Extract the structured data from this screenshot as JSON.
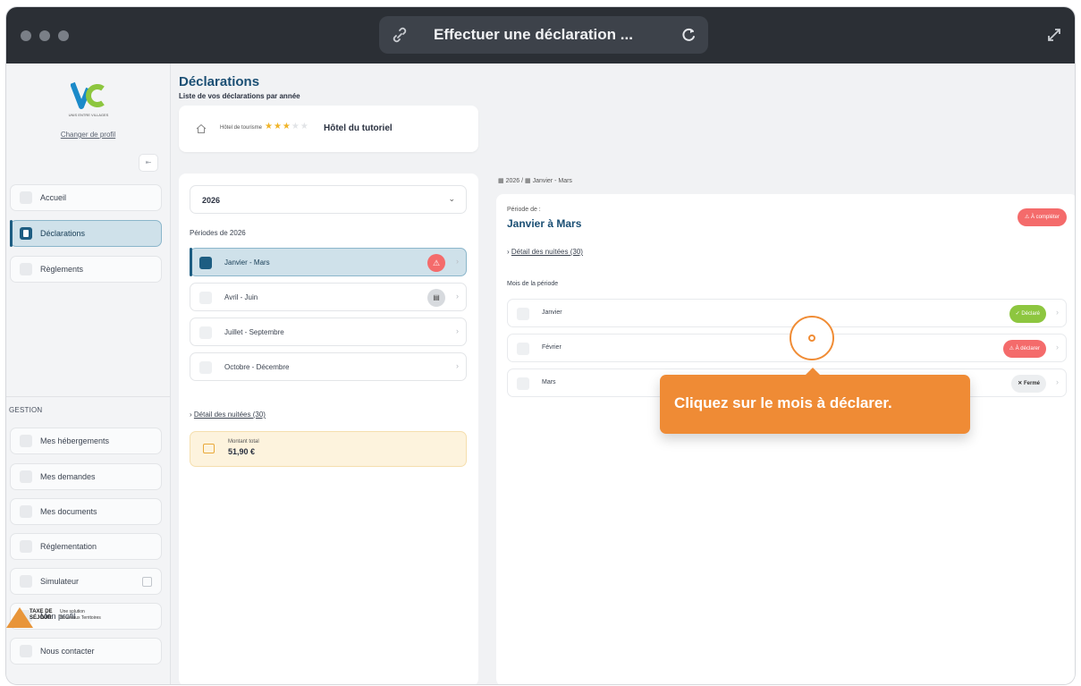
{
  "window": {
    "title": "Effectuer une déclaration ...",
    "icons": {
      "link": "link-icon",
      "reload": "reload-icon",
      "expand": "expand-icon"
    }
  },
  "sidebar": {
    "logo_letters": "VC",
    "logo_sub": "UNIS ENTRE VILLAGES",
    "change_profile": "Changer de profil",
    "collapse_label": "⇤",
    "items": [
      {
        "label": "Accueil",
        "icon": "home-icon"
      },
      {
        "label": "Déclarations",
        "icon": "document-icon",
        "active": true
      },
      {
        "label": "Règlements",
        "icon": "payment-icon"
      }
    ],
    "section_title": "GESTION",
    "gestion_items": [
      {
        "label": "Mes hébergements",
        "icon": "building-icon"
      },
      {
        "label": "Mes demandes",
        "icon": "request-icon"
      },
      {
        "label": "Mes documents",
        "icon": "folder-icon"
      },
      {
        "label": "Réglementation",
        "icon": "law-icon"
      },
      {
        "label": "Simulateur",
        "icon": "calculator-icon"
      },
      {
        "label": "Mon profil",
        "icon": "user-icon"
      },
      {
        "label": "Nous contacter",
        "icon": "mail-icon"
      }
    ],
    "footer": {
      "brand_line1": "TAXE DE",
      "brand_line2": "SÉJOUR",
      "tagline1": "Une solution",
      "tagline2": "Nouveaux Territoires"
    }
  },
  "main": {
    "title": "Déclarations",
    "subtitle": "Liste de vos déclarations par année",
    "hotel": {
      "type": "Hôtel de tourisme",
      "stars_filled": "★★★",
      "stars_empty": "★★",
      "name": "Hôtel du tutoriel"
    },
    "year": "2026",
    "periods_title": "Périodes de 2026",
    "periods": [
      {
        "label": "Janvier - Mars",
        "status_icon": "⚠"
      },
      {
        "label": "Avril - Juin",
        "status_icon": "▤"
      },
      {
        "label": "Juillet - Septembre"
      },
      {
        "label": "Octobre - Décembre"
      }
    ],
    "detail_link": "Détail des nuitées (30)",
    "amount": {
      "label": "Montant total",
      "value": "51,90 €"
    },
    "breadcrumb": {
      "year": "2026",
      "separator": "/",
      "period": "Janvier - Mars"
    },
    "period_detail": {
      "of_label": "Période de :",
      "name": "Janvier à Mars",
      "badge": "⚠ À compléter",
      "detail_link": "Détail des nuitées (30)",
      "months_title": "Mois de la période",
      "months": [
        {
          "label": "Janvier",
          "badge": "✓ Déclaré",
          "status": "green"
        },
        {
          "label": "Février",
          "badge": "⚠ À déclarer",
          "status": "red"
        },
        {
          "label": "Mars",
          "badge": "✕ Fermé",
          "status": "gray"
        }
      ]
    }
  },
  "tutorial": {
    "tooltip": "Cliquez sur le mois à déclarer."
  },
  "colors": {
    "accent": "#1b4f74",
    "orange": "#ef8b35",
    "danger": "#f46b6b",
    "success": "#8dc63f"
  }
}
